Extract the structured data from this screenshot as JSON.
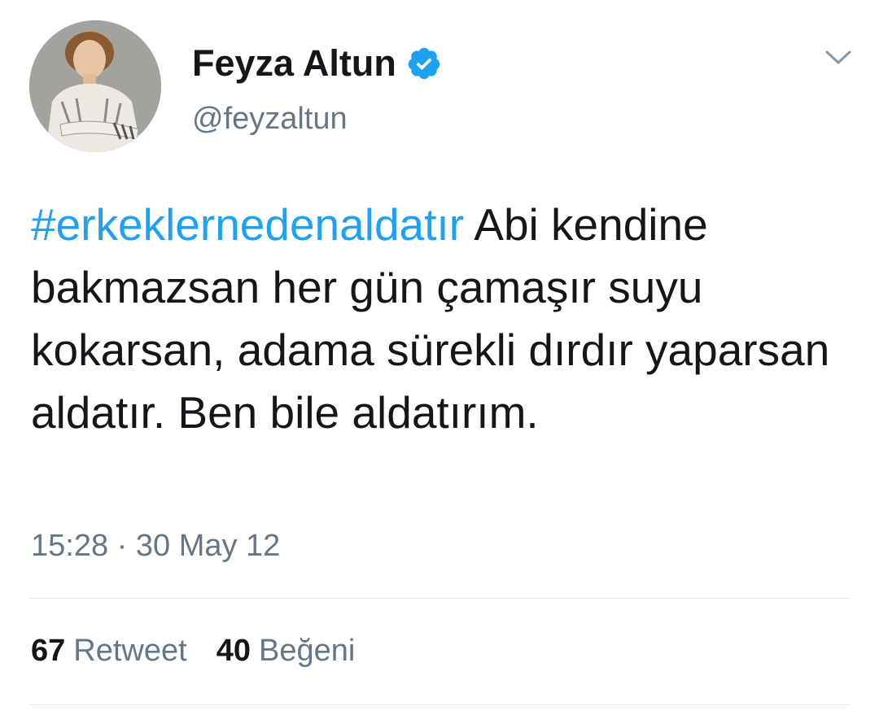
{
  "user": {
    "display_name": "Feyza Altun",
    "handle": "@feyzaltun",
    "verified_icon": "verified-badge-icon"
  },
  "tweet": {
    "hashtag": "#erkeklernedenaldatır",
    "text": " Abi kendine bakmazsan her gün çamaşır suyu kokarsan, adama sürekli dırdır yaparsan aldatır. Ben bile aldatırım.",
    "timestamp": "15:28 · 30 May 12"
  },
  "stats": {
    "retweet_count": "67",
    "retweet_label": "Retweet",
    "like_count": "40",
    "like_label": "Beğeni"
  },
  "colors": {
    "link": "#1da1f2",
    "secondary_text": "#657786",
    "primary_text": "#14171a",
    "divider": "#e1e8ed"
  }
}
